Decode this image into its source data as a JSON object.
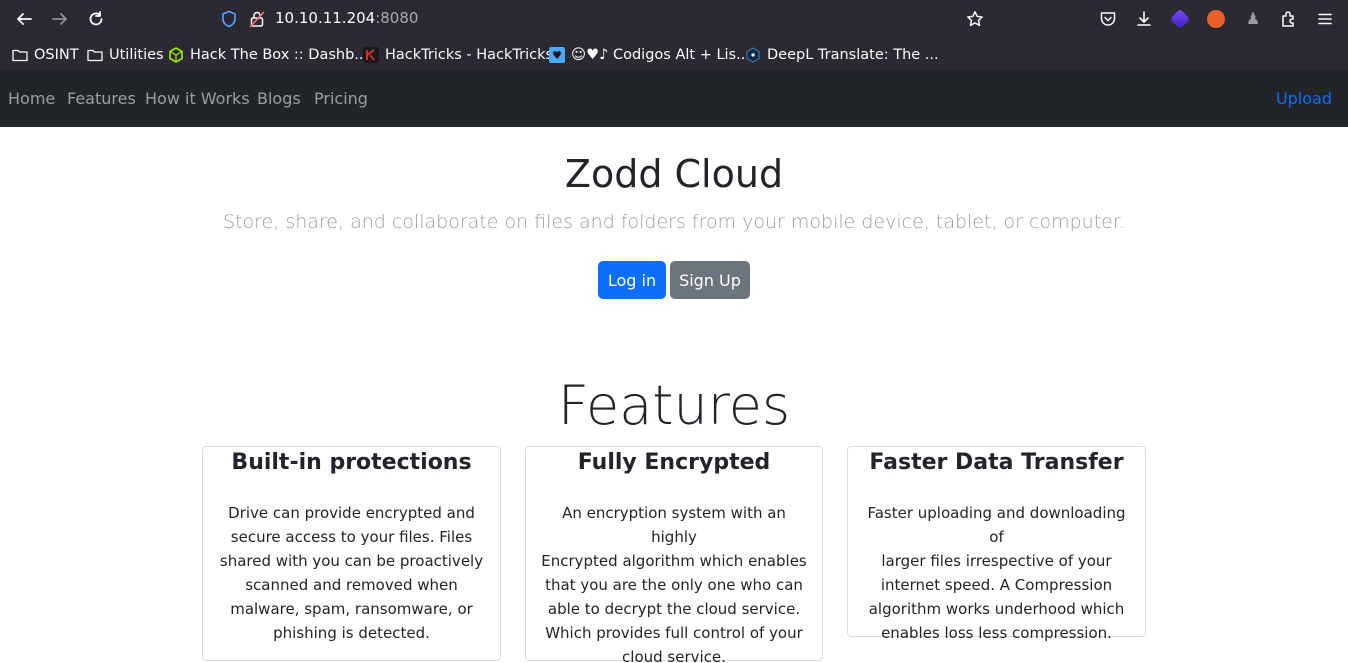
{
  "browser": {
    "url_host": "10.10.11.204",
    "url_port": ":8080",
    "bookmarks": [
      {
        "label": "OSINT",
        "icon": "folder-icon"
      },
      {
        "label": "Utilities",
        "icon": "folder-icon"
      },
      {
        "label": "Hack The Box :: Dashb...",
        "icon": "hackthebox-icon"
      },
      {
        "label": "HackTricks - HackTricks",
        "icon": "hacktricks-icon"
      },
      {
        "label": "☺♥♪ Codigos Alt + Lis...",
        "icon": "heart-icon"
      },
      {
        "label": "DeepL Translate: The ...",
        "icon": "deepl-icon"
      }
    ]
  },
  "nav": {
    "links": [
      "Home",
      "Features",
      "How it Works",
      "Blogs",
      "Pricing"
    ],
    "upload": "Upload"
  },
  "hero": {
    "title": "Zodd Cloud",
    "lead": "Store, share, and collaborate on files and folders from your mobile device, tablet, or computer.",
    "login_label": "Log in",
    "signup_label": "Sign Up"
  },
  "features": {
    "heading": "Features",
    "cards": [
      {
        "title": "Built-in protections",
        "body": [
          "Drive can provide encrypted and",
          "secure access to your files. Files",
          "shared with you can be proactively",
          "scanned and removed when",
          "malware, spam, ransomware, or",
          "phishing is detected."
        ]
      },
      {
        "title": "Fully Encrypted",
        "body": [
          "An encryption system with an highly",
          "Encrypted algorithm which enables",
          "that you are the only one who can",
          "able to decrypt the cloud service.",
          "Which provides full control of your",
          "cloud service."
        ]
      },
      {
        "title": "Faster Data Transfer",
        "body": [
          "Faster uploading and downloading of",
          "larger files irrespective of your",
          "internet speed. A Compression",
          "algorithm works underhood which",
          "enables loss less compression."
        ]
      }
    ]
  },
  "colors": {
    "browser_bg": "#2b2a33",
    "navbar_bg": "#212529",
    "primary": "#0d6efd",
    "secondary": "#6c757d"
  }
}
